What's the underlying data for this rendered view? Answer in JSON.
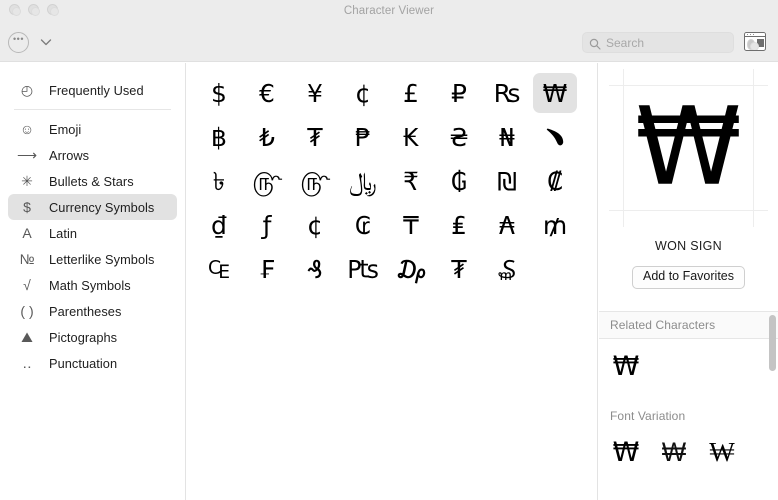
{
  "window": {
    "title": "Character Viewer",
    "traffic_lights": [
      "close",
      "minimize",
      "zoom"
    ]
  },
  "toolbar": {
    "options_button_glyph": "•••",
    "chevron_icon": "chevron-down",
    "search": {
      "placeholder": "Search",
      "value": ""
    },
    "panel_toggle_name": "show-keyboard-viewer"
  },
  "sidebar": {
    "items": [
      {
        "icon": "clock-icon",
        "glyph": "◴",
        "label": "Frequently Used",
        "selected": false
      },
      {
        "icon": "smiley-icon",
        "glyph": "☺",
        "label": "Emoji",
        "selected": false
      },
      {
        "icon": "arrow-right-icon",
        "glyph": "⟶",
        "label": "Arrows",
        "selected": false
      },
      {
        "icon": "asterisk-icon",
        "glyph": "✳",
        "label": "Bullets & Stars",
        "selected": false
      },
      {
        "icon": "dollar-icon",
        "glyph": "$",
        "label": "Currency Symbols",
        "selected": true
      },
      {
        "icon": "letter-a-icon",
        "glyph": "A",
        "label": "Latin",
        "selected": false
      },
      {
        "icon": "numero-icon",
        "glyph": "№",
        "label": "Letterlike Symbols",
        "selected": false
      },
      {
        "icon": "radical-icon",
        "glyph": "√",
        "label": "Math Symbols",
        "selected": false
      },
      {
        "icon": "parentheses-icon",
        "glyph": "( )",
        "label": "Parentheses",
        "selected": false
      },
      {
        "icon": "pictograph-icon",
        "glyph": "⛰",
        "label": "Pictographs",
        "selected": false
      },
      {
        "icon": "punctuation-icon",
        "glyph": "‥",
        "label": "Punctuation",
        "selected": false
      }
    ],
    "divider_after_index": 0
  },
  "grid": {
    "columns": 8,
    "selected_index": 7,
    "characters": [
      "$",
      "€",
      "¥",
      "¢",
      "£",
      "₽",
      "₨",
      "₩",
      "฿",
      "₺",
      "₮",
      "₱",
      "₭",
      "₴",
      "₦",
      "﹅",
      "৳",
      "௹",
      "௹",
      "﷼",
      "₹",
      "₲",
      "₪",
      "₡",
      "₫",
      "ƒ",
      "¢",
      "₢",
      "₸",
      "₤",
      "₳",
      "₥",
      "₠",
      "₣",
      "₰",
      "₧",
      "₯",
      "₮",
      "₷"
    ]
  },
  "detail": {
    "preview_char": "₩",
    "char_name": "WON SIGN",
    "add_to_favorites_label": "Add to Favorites",
    "related_section_title": "Related Characters",
    "related_characters": [
      "₩"
    ],
    "font_variation_title": "Font Variation",
    "font_variations": [
      "₩",
      "₩",
      "₩"
    ]
  },
  "colors": {
    "chrome_bg": "#ececec",
    "content_bg": "#ffffff",
    "selection_gray": "#e2e2e2",
    "divider": "#e3e3e3",
    "title_text": "#a3a3a3",
    "section_text": "#8c8c8c",
    "scrollbar": "#c4c4c4"
  }
}
